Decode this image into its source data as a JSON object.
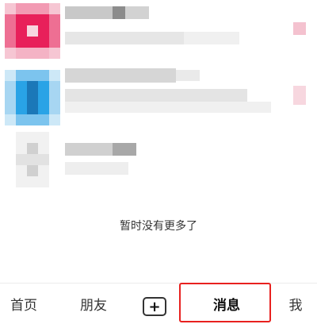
{
  "list": {
    "empty_tip": "暂时没有更多了"
  },
  "tabbar": {
    "home": "首页",
    "friends": "朋友",
    "add": "+",
    "messages": "消息",
    "me": "我"
  },
  "colors": {
    "avatar_1": "#e8205a",
    "avatar_2": "#29a3e6",
    "highlight": "#e8211f"
  }
}
